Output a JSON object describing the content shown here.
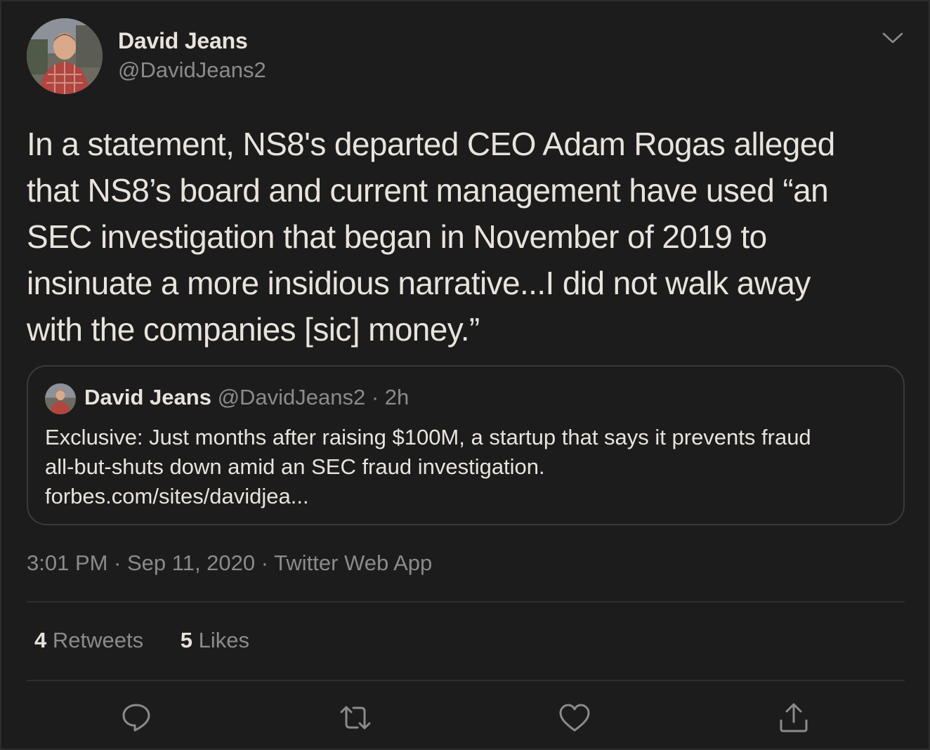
{
  "author": {
    "name": "David Jeans",
    "handle": "@DavidJeans2"
  },
  "tweet": {
    "text": "In a statement, NS8's departed CEO Adam Rogas alleged\nthat NS8’s board and current management have used “an\nSEC investigation that began in November of 2019 to\ninsinuate a more insidious narrative...I did not walk away\nwith the companies [sic] money.”",
    "timestamp": "3:01 PM · Sep 11, 2020 · Twitter Web App"
  },
  "quoted_tweet": {
    "name": "David Jeans",
    "meta": "@DavidJeans2 · 2h",
    "text": "Exclusive: Just months after raising $100M, a startup that says it prevents fraud\nall-but-shuts down amid an SEC fraud investigation.\nforbes.com/sites/davidjea..."
  },
  "stats": {
    "retweets_count": "4",
    "retweets_label": "Retweets",
    "likes_count": "5",
    "likes_label": "Likes"
  },
  "icons": {
    "caret": "chevron-down-icon",
    "reply": "reply-icon",
    "retweet": "retweet-icon",
    "like": "heart-icon",
    "share": "share-icon"
  },
  "colors": {
    "background": "#1c1c1c",
    "text": "#e8e3dc",
    "secondary": "#8b8b8b",
    "border": "#3a3a3a"
  }
}
